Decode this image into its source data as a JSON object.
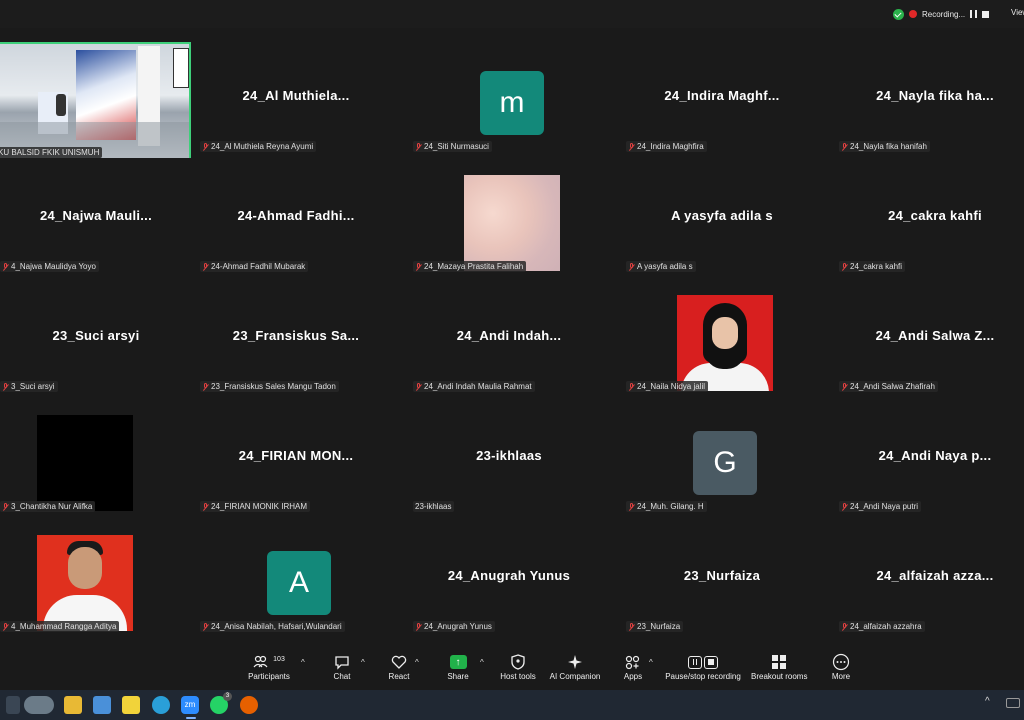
{
  "header": {
    "recording_text": "Recording...",
    "view_text": "View"
  },
  "tiles": [
    {
      "id": "t1",
      "name": "",
      "label": "KU BALSID FKIK UNISMUH",
      "type": "video"
    },
    {
      "id": "t2",
      "name": "24_Al  Muthiela...",
      "label": "24_Al Muthiela Reyna Ayumi"
    },
    {
      "id": "t3",
      "name": "",
      "label": "24_Siti Nurmasuci",
      "avatar": "m",
      "avatar_color": "#13897a"
    },
    {
      "id": "t4",
      "name": "24_Indira  Maghf...",
      "label": "24_Indira Maghfira"
    },
    {
      "id": "t5",
      "name": "24_Nayla  fika  ha...",
      "label": "24_Nayla fika hanifah"
    },
    {
      "id": "t6",
      "name": "24_Najwa  Mauli...",
      "label": "4_Najwa Maulidya Yoyo"
    },
    {
      "id": "t7",
      "name": "24-Ahmad  Fadhi...",
      "label": "24-Ahmad Fadhil Mubarak"
    },
    {
      "id": "t8",
      "name": "",
      "label": "24_Mazaya Prastita Falihah",
      "type": "sky"
    },
    {
      "id": "t9",
      "name": "A yasyfa adila s",
      "label": "A yasyfa adila s"
    },
    {
      "id": "t10",
      "name": "24_cakra kahfi",
      "label": "24_cakra kahfi"
    },
    {
      "id": "t11",
      "name": "23_Suci arsyi",
      "label": "3_Suci arsyi"
    },
    {
      "id": "t12",
      "name": "23_Fransiskus  Sa...",
      "label": "23_Fransiskus Sales Mangu Tadon"
    },
    {
      "id": "t13",
      "name": "24_Andi  Indah...",
      "label": "24_Andi Indah Maulia Rahmat"
    },
    {
      "id": "t14",
      "name": "",
      "label": "24_Naila Nidya jalil",
      "type": "hijab"
    },
    {
      "id": "t15",
      "name": "24_Andi  Salwa  Z...",
      "label": "24_Andi Salwa Zhafirah"
    },
    {
      "id": "t16",
      "name": "",
      "label": "3_Chantikha Nur Alifka",
      "type": "black"
    },
    {
      "id": "t17",
      "name": "24_FIRIAN  MON...",
      "label": "24_FIRIAN MONIK IRHAM"
    },
    {
      "id": "t18",
      "name": "23-ikhlaas",
      "label": "23-ikhlaas",
      "nomic": true
    },
    {
      "id": "t19",
      "name": "",
      "label": "24_Muh. Gilang. H",
      "avatar": "G",
      "avatar_color": "#4a5a63"
    },
    {
      "id": "t20",
      "name": "24_Andi  Naya  p...",
      "label": "24_Andi Naya putri"
    },
    {
      "id": "t21",
      "name": "",
      "label": "4_Muhammad Rangga Aditya",
      "type": "man"
    },
    {
      "id": "t22",
      "name": "",
      "label": "24_Anisa Nabilah, Hafsari,Wulandari",
      "avatar": "A",
      "avatar_color": "#13897a"
    },
    {
      "id": "t23",
      "name": "24_Anugrah Yunus",
      "label": "24_Anugrah Yunus"
    },
    {
      "id": "t24",
      "name": "23_Nurfaiza",
      "label": "23_Nurfaiza"
    },
    {
      "id": "t25",
      "name": "24_alfaizah  azza...",
      "label": "24_alfaizah azzahra"
    }
  ],
  "toolbar": {
    "participants_count": "103",
    "participants": "Participants",
    "chat": "Chat",
    "react": "React",
    "share": "Share",
    "host_tools": "Host tools",
    "ai_companion": "AI Companion",
    "apps": "Apps",
    "pause_stop": "Pause/stop recording",
    "breakout": "Breakout rooms",
    "more": "More"
  },
  "taskbar": {
    "whatsapp_badge": "3"
  }
}
